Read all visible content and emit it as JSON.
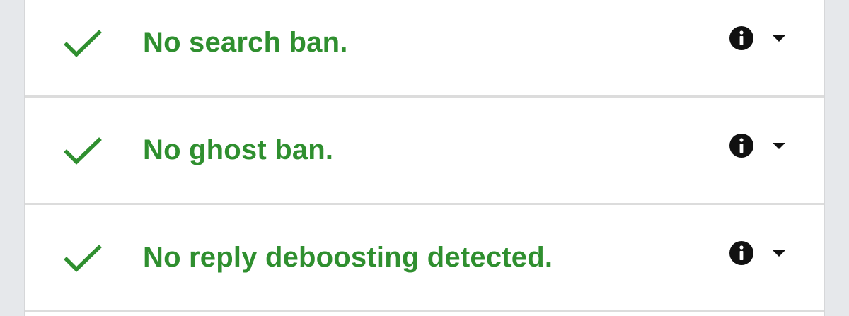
{
  "colors": {
    "success": "#2f8f2f",
    "background": "#e6e8eb",
    "card": "#ffffff",
    "divider": "#dcdcdc",
    "icon": "#111111"
  },
  "results": [
    {
      "label": "No search ban.",
      "status_icon": "check-icon",
      "info_icon": "info-icon",
      "toggle_icon": "chevron-down-icon"
    },
    {
      "label": "No ghost ban.",
      "status_icon": "check-icon",
      "info_icon": "info-icon",
      "toggle_icon": "chevron-down-icon"
    },
    {
      "label": "No reply deboosting detected.",
      "status_icon": "check-icon",
      "info_icon": "info-icon",
      "toggle_icon": "chevron-down-icon"
    }
  ]
}
